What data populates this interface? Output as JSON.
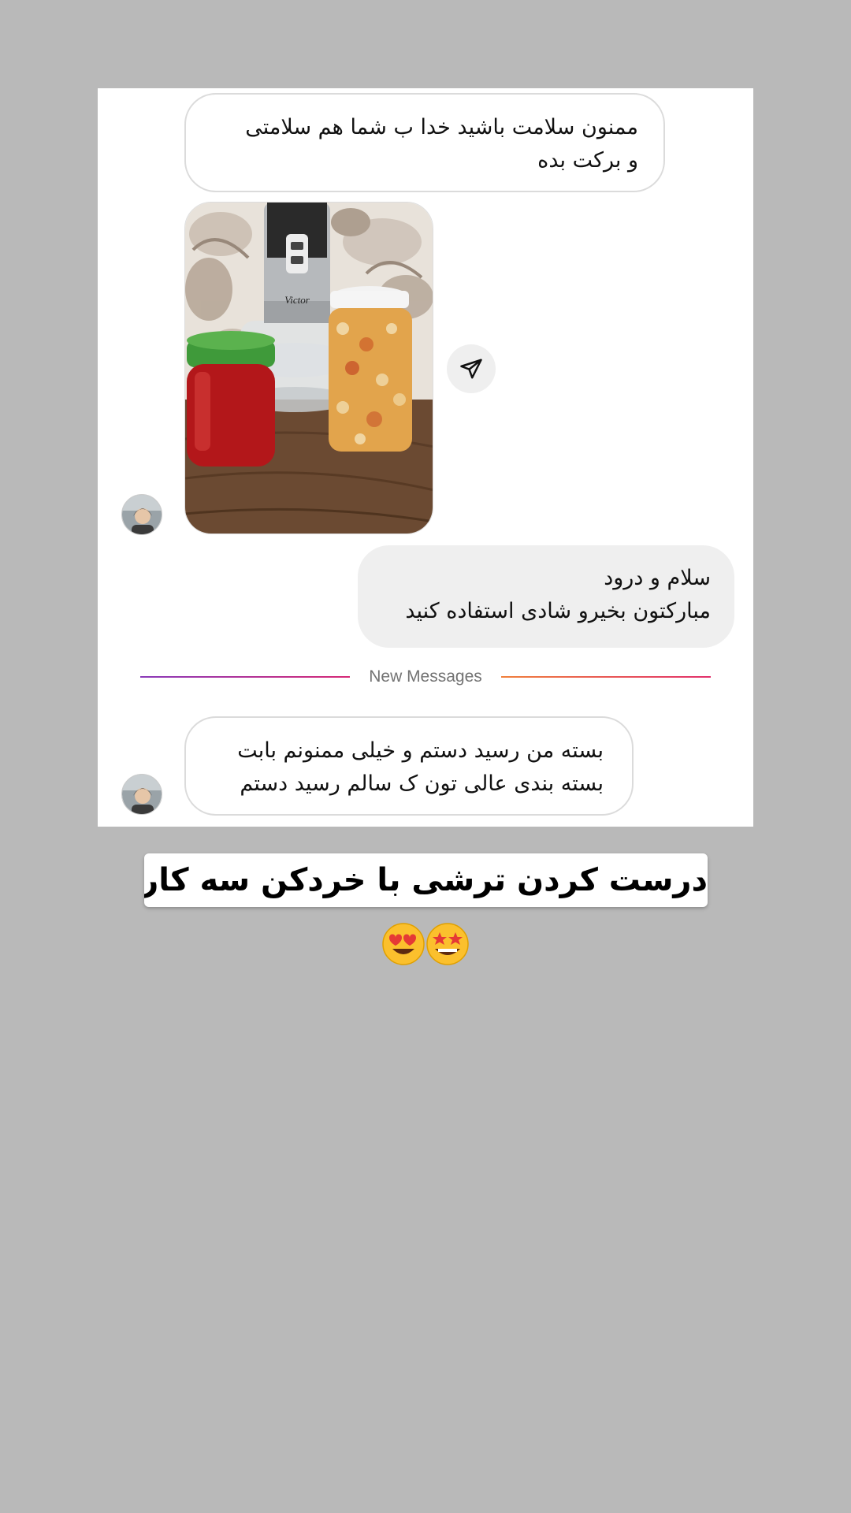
{
  "conversation": {
    "messages": [
      {
        "direction": "incoming",
        "lines": [
          "ممنون سلامت باشید خدا ب شما هم سلامتی",
          "و برکت بده"
        ]
      },
      {
        "direction": "outgoing",
        "lines": [
          "سلام و درود",
          "مبارکتون بخیرو شادی استفاده کنید"
        ]
      },
      {
        "direction": "incoming",
        "lines": [
          "بسته من رسید دستم و خیلی ممنونم بابت",
          "بسته بندی عالی تون ک سالم رسید دستم"
        ]
      }
    ],
    "photo_brand": "Victor",
    "new_messages_label": "New Messages"
  },
  "caption": {
    "text": "درست کردن ترشی با خردکن سه کاره ویکتور"
  },
  "emojis": [
    "heart-eyes-emoji",
    "star-struck-emoji"
  ],
  "colors": {
    "background": "#b9b9b9",
    "incoming_bubble_border": "#dbdbdb",
    "outgoing_bubble": "#efefef",
    "divider_gradient_start": "#8a3ab9",
    "divider_gradient_end": "#e1306c"
  }
}
